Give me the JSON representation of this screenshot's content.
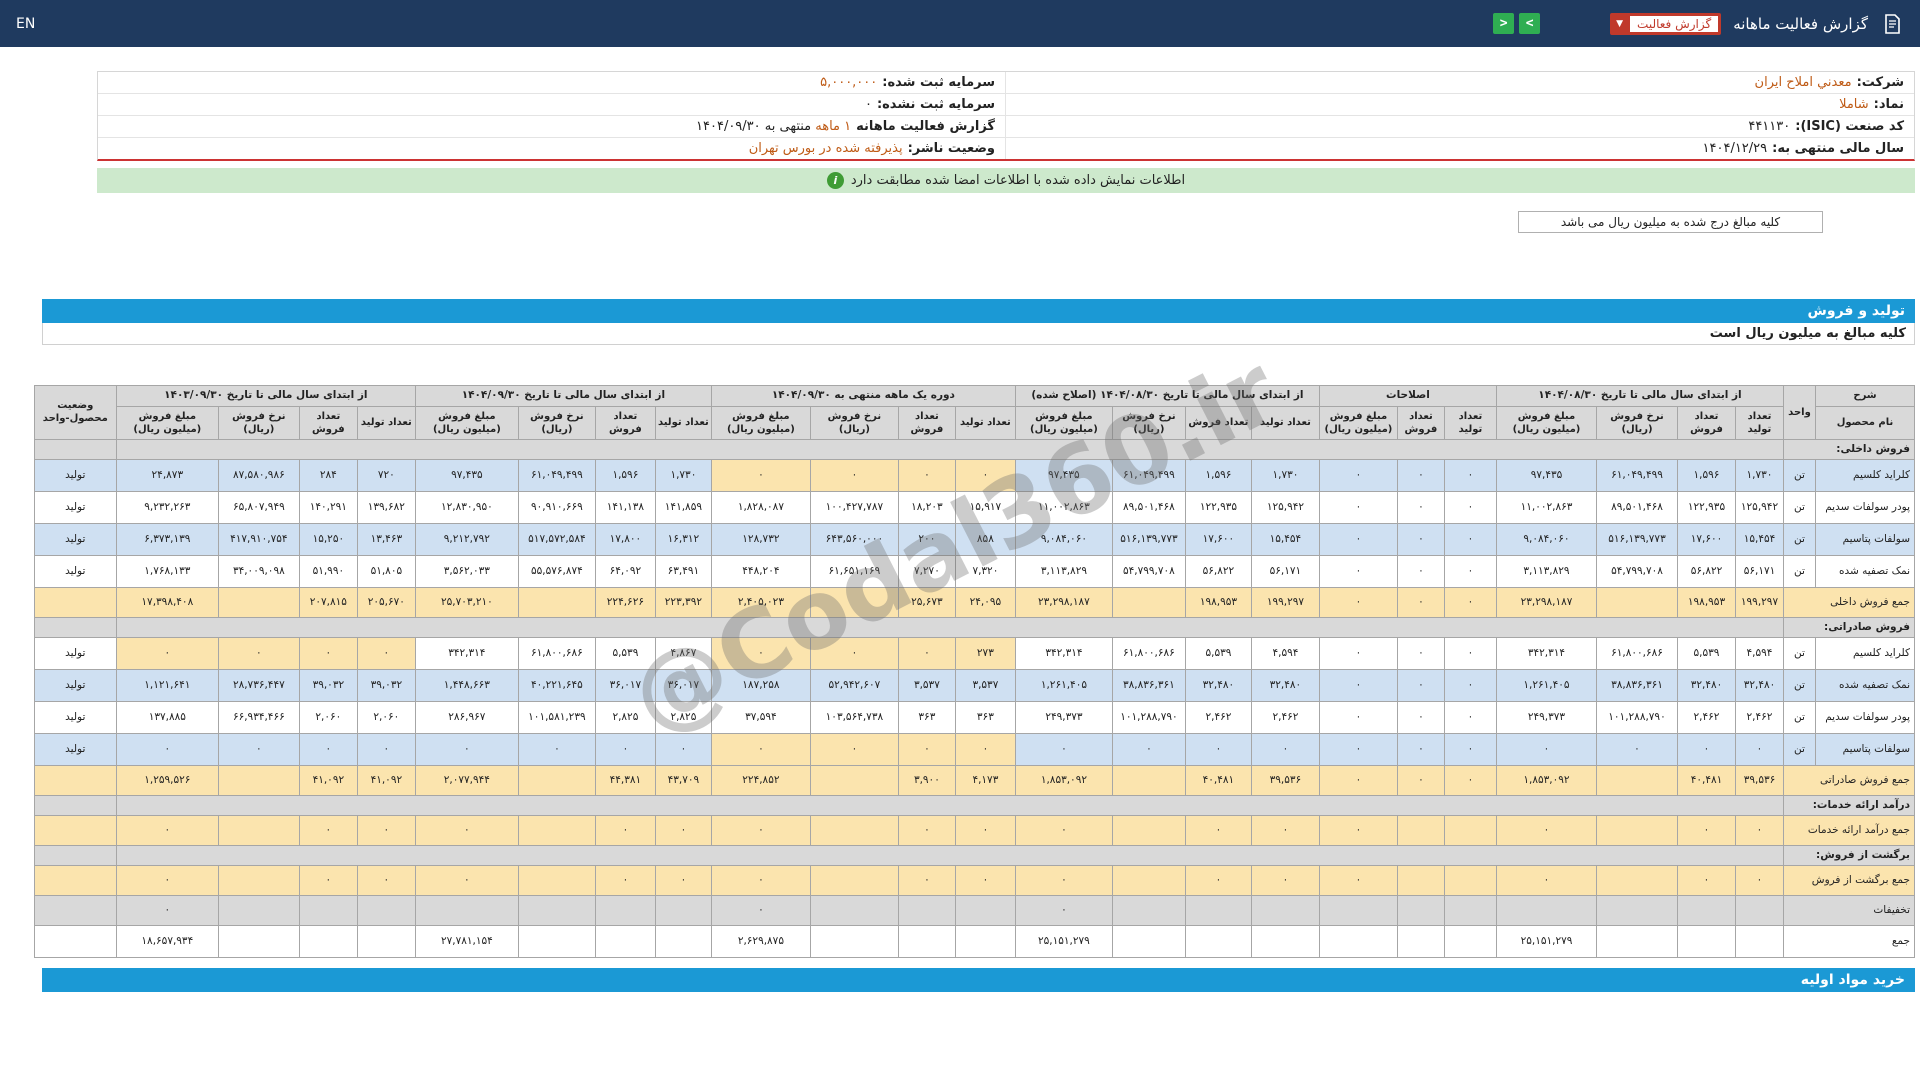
{
  "colors": {
    "navbar_bg": "#1f3a5f",
    "accent_blue": "#1b99d5",
    "accent_red": "#c0392b",
    "accent_green": "#2fae52",
    "notice_bg": "#cde9cc",
    "notice_icon": "#3f9c35",
    "cream": "#fbe4ae",
    "row_blue": "#cfe0f2",
    "grey": "#d9d9d9",
    "orange": "#bf5b16",
    "tbl_border": "#a6a6a6",
    "red_line": "#cc3333"
  },
  "navbar": {
    "brand": "گزارش فعالیت ماهانه",
    "dropdown_label": "گزارش فعالیت",
    "en_label": "EN",
    "next_label": ">",
    "prev_label": "<"
  },
  "info": {
    "rows": [
      {
        "right": {
          "label": "شرکت:",
          "value": "معدني املاح ایران",
          "cls": "orange"
        },
        "left": {
          "label": "سرمایه ثبت شده:",
          "value": "۵,۰۰۰,۰۰۰",
          "cls": "orange"
        }
      },
      {
        "right": {
          "label": "نماد:",
          "value": "شاملا",
          "cls": "orange"
        },
        "left": {
          "label": "سرمایه ثبت نشده:",
          "value": "۰",
          "cls": "dark"
        }
      },
      {
        "right": {
          "label": "کد صنعت (ISIC):",
          "value": "۴۴۱۱۳۰",
          "cls": "dark"
        },
        "left": {
          "label": "گزارش فعالیت ماهانه",
          "value": "۱ ماهه",
          "cls": "orange",
          "suffix": "منتهی به ۱۴۰۴/۰۹/۳۰"
        }
      },
      {
        "right": {
          "label": "سال مالی منتهی به:",
          "value": "۱۴۰۴/۱۲/۲۹",
          "cls": "dark"
        },
        "left": {
          "label": "وضعیت ناشر:",
          "value": "پذیرفته شده در بورس تهران",
          "cls": "orange"
        }
      }
    ]
  },
  "notice": {
    "text": "اطلاعات نمایش داده شده با اطلاعات امضا شده مطابقت دارد"
  },
  "unit_note": "کلیه مبالغ درج شده به میلیون ریال می باشد",
  "section1_title": "تولید و فروش",
  "table_note": "کلیه مبالغ به میلیون ریال است",
  "bottom_section_title": "خرید مواد اولیه",
  "watermark": "@Codal360.ir",
  "table": {
    "corner": {
      "sharh": "شرح",
      "name": "نام محصول",
      "unit": "واحد",
      "status": "وضعیت محصول-واحد"
    },
    "groups": [
      {
        "title": "از ابتدای سال مالی تا تاریخ ۱۴۰۴/۰۸/۳۰",
        "cols": [
          "تعداد تولید",
          "تعداد فروش",
          "نرخ فروش (ریال)",
          "مبلغ فروش (میلیون ریال)"
        ]
      },
      {
        "title": "اصلاحات",
        "cols": [
          "تعداد تولید",
          "تعداد فروش",
          "مبلغ فروش (میلیون ریال)"
        ]
      },
      {
        "title": "از ابتدای سال مالی تا تاریخ ۱۴۰۴/۰۸/۳۰ (اصلاح شده)",
        "cols": [
          "تعداد تولید",
          "تعداد فروش",
          "نرخ فروش (ریال)",
          "مبلغ فروش (میلیون ریال)"
        ]
      },
      {
        "title": "دوره یک ماهه منتهی به ۱۴۰۴/۰۹/۳۰",
        "cols": [
          "تعداد تولید",
          "تعداد فروش",
          "نرخ فروش (ریال)",
          "مبلغ فروش (میلیون ریال)"
        ]
      },
      {
        "title": "از ابتدای سال مالی تا تاریخ ۱۴۰۴/۰۹/۳۰",
        "cols": [
          "تعداد تولید",
          "تعداد فروش",
          "نرخ فروش (ریال)",
          "مبلغ فروش (میلیون ریال)"
        ]
      },
      {
        "title": "از ابتدای سال مالی تا تاریخ ۱۴۰۳/۰۹/۳۰",
        "cols": [
          "تعداد تولید",
          "تعداد فروش",
          "نرخ فروش (ریال)",
          "مبلغ فروش (میلیون ریال)"
        ]
      }
    ],
    "rows": [
      {
        "type": "section",
        "label": "فروش داخلی:"
      },
      {
        "type": "product",
        "name": "کلراید کلسیم",
        "unit": "تن",
        "status": "تولید",
        "cls": "blue",
        "cream": [
          3
        ],
        "g": [
          [
            "۱,۷۳۰",
            "۱,۵۹۶",
            "۶۱,۰۴۹,۴۹۹",
            "۹۷,۴۳۵"
          ],
          [
            "۰",
            "۰",
            "۰"
          ],
          [
            "۱,۷۳۰",
            "۱,۵۹۶",
            "۶۱,۰۴۹,۴۹۹",
            "۹۷,۴۳۵"
          ],
          [
            "۰",
            "۰",
            "۰",
            "۰"
          ],
          [
            "۱,۷۳۰",
            "۱,۵۹۶",
            "۶۱,۰۴۹,۴۹۹",
            "۹۷,۴۳۵"
          ],
          [
            "۷۲۰",
            "۲۸۴",
            "۸۷,۵۸۰,۹۸۶",
            "۲۴,۸۷۳"
          ]
        ]
      },
      {
        "type": "product",
        "name": "پودر سولفات سدیم",
        "unit": "تن",
        "status": "تولید",
        "cls": "white",
        "cream": [],
        "g": [
          [
            "۱۲۵,۹۴۲",
            "۱۲۲,۹۳۵",
            "۸۹,۵۰۱,۴۶۸",
            "۱۱,۰۰۲,۸۶۳"
          ],
          [
            "۰",
            "۰",
            "۰"
          ],
          [
            "۱۲۵,۹۴۲",
            "۱۲۲,۹۳۵",
            "۸۹,۵۰۱,۴۶۸",
            "۱۱,۰۰۲,۸۶۳"
          ],
          [
            "۱۵,۹۱۷",
            "۱۸,۲۰۳",
            "۱۰۰,۴۲۷,۷۸۷",
            "۱,۸۲۸,۰۸۷"
          ],
          [
            "۱۴۱,۸۵۹",
            "۱۴۱,۱۳۸",
            "۹۰,۹۱۰,۶۶۹",
            "۱۲,۸۳۰,۹۵۰"
          ],
          [
            "۱۳۹,۶۸۲",
            "۱۴۰,۲۹۱",
            "۶۵,۸۰۷,۹۴۹",
            "۹,۲۳۲,۲۶۳"
          ]
        ]
      },
      {
        "type": "product",
        "name": "سولفات پتاسیم",
        "unit": "تن",
        "status": "تولید",
        "cls": "blue",
        "cream": [],
        "g": [
          [
            "۱۵,۴۵۴",
            "۱۷,۶۰۰",
            "۵۱۶,۱۳۹,۷۷۳",
            "۹,۰۸۴,۰۶۰"
          ],
          [
            "۰",
            "۰",
            "۰"
          ],
          [
            "۱۵,۴۵۴",
            "۱۷,۶۰۰",
            "۵۱۶,۱۳۹,۷۷۳",
            "۹,۰۸۴,۰۶۰"
          ],
          [
            "۸۵۸",
            "۲۰۰",
            "۶۴۳,۵۶۰,۰۰۰",
            "۱۲۸,۷۳۲"
          ],
          [
            "۱۶,۳۱۲",
            "۱۷,۸۰۰",
            "۵۱۷,۵۷۲,۵۸۴",
            "۹,۲۱۲,۷۹۲"
          ],
          [
            "۱۳,۴۶۳",
            "۱۵,۲۵۰",
            "۴۱۷,۹۱۰,۷۵۴",
            "۶,۳۷۳,۱۳۹"
          ]
        ]
      },
      {
        "type": "product",
        "name": "نمک تصفیه شده",
        "unit": "تن",
        "status": "تولید",
        "cls": "white",
        "cream": [],
        "g": [
          [
            "۵۶,۱۷۱",
            "۵۶,۸۲۲",
            "۵۴,۷۹۹,۷۰۸",
            "۳,۱۱۳,۸۲۹"
          ],
          [
            "۰",
            "۰",
            "۰"
          ],
          [
            "۵۶,۱۷۱",
            "۵۶,۸۲۲",
            "۵۴,۷۹۹,۷۰۸",
            "۳,۱۱۳,۸۲۹"
          ],
          [
            "۷,۳۲۰",
            "۷,۲۷۰",
            "۶۱,۶۵۱,۱۶۹",
            "۴۴۸,۲۰۴"
          ],
          [
            "۶۳,۴۹۱",
            "۶۴,۰۹۲",
            "۵۵,۵۷۶,۸۷۴",
            "۳,۵۶۲,۰۳۳"
          ],
          [
            "۵۱,۸۰۵",
            "۵۱,۹۹۰",
            "۳۴,۰۰۹,۰۹۸",
            "۱,۷۶۸,۱۳۳"
          ]
        ]
      },
      {
        "type": "total",
        "label": "جمع فروش داخلی",
        "cls": "cream",
        "g": [
          [
            "۱۹۹,۲۹۷",
            "۱۹۸,۹۵۳",
            "",
            "۲۳,۲۹۸,۱۸۷"
          ],
          [
            "۰",
            "۰",
            "۰"
          ],
          [
            "۱۹۹,۲۹۷",
            "۱۹۸,۹۵۳",
            "",
            "۲۳,۲۹۸,۱۸۷"
          ],
          [
            "۲۴,۰۹۵",
            "۲۵,۶۷۳",
            "",
            "۲,۴۰۵,۰۲۳"
          ],
          [
            "۲۲۳,۳۹۲",
            "۲۲۴,۶۲۶",
            "",
            "۲۵,۷۰۳,۲۱۰"
          ],
          [
            "۲۰۵,۶۷۰",
            "۲۰۷,۸۱۵",
            "",
            "۱۷,۳۹۸,۴۰۸"
          ]
        ]
      },
      {
        "type": "section",
        "label": "فروش صادراتی:"
      },
      {
        "type": "product",
        "name": "کلراید کلسیم",
        "unit": "تن",
        "status": "تولید",
        "cls": "white",
        "cream": [
          3,
          5
        ],
        "g": [
          [
            "۴,۵۹۴",
            "۵,۵۳۹",
            "۶۱,۸۰۰,۶۸۶",
            "۳۴۲,۳۱۴"
          ],
          [
            "۰",
            "۰",
            "۰"
          ],
          [
            "۴,۵۹۴",
            "۵,۵۳۹",
            "۶۱,۸۰۰,۶۸۶",
            "۳۴۲,۳۱۴"
          ],
          [
            "۲۷۳",
            "۰",
            "۰",
            "۰"
          ],
          [
            "۴,۸۶۷",
            "۵,۵۳۹",
            "۶۱,۸۰۰,۶۸۶",
            "۳۴۲,۳۱۴"
          ],
          [
            "۰",
            "۰",
            "۰",
            "۰"
          ]
        ]
      },
      {
        "type": "product",
        "name": "نمک تصفیه شده",
        "unit": "تن",
        "status": "تولید",
        "cls": "blue",
        "cream": [],
        "g": [
          [
            "۳۲,۴۸۰",
            "۳۲,۴۸۰",
            "۳۸,۸۳۶,۳۶۱",
            "۱,۲۶۱,۴۰۵"
          ],
          [
            "۰",
            "۰",
            "۰"
          ],
          [
            "۳۲,۴۸۰",
            "۳۲,۴۸۰",
            "۳۸,۸۳۶,۳۶۱",
            "۱,۲۶۱,۴۰۵"
          ],
          [
            "۳,۵۳۷",
            "۳,۵۳۷",
            "۵۲,۹۴۲,۶۰۷",
            "۱۸۷,۲۵۸"
          ],
          [
            "۳۶,۰۱۷",
            "۳۶,۰۱۷",
            "۴۰,۲۲۱,۶۴۵",
            "۱,۴۴۸,۶۶۳"
          ],
          [
            "۳۹,۰۳۲",
            "۳۹,۰۳۲",
            "۲۸,۷۳۶,۴۴۷",
            "۱,۱۲۱,۶۴۱"
          ]
        ]
      },
      {
        "type": "product",
        "name": "پودر سولفات سدیم",
        "unit": "تن",
        "status": "تولید",
        "cls": "white",
        "cream": [],
        "g": [
          [
            "۲,۴۶۲",
            "۲,۴۶۲",
            "۱۰۱,۲۸۸,۷۹۰",
            "۲۴۹,۳۷۳"
          ],
          [
            "۰",
            "۰",
            "۰"
          ],
          [
            "۲,۴۶۲",
            "۲,۴۶۲",
            "۱۰۱,۲۸۸,۷۹۰",
            "۲۴۹,۳۷۳"
          ],
          [
            "۳۶۳",
            "۳۶۳",
            "۱۰۳,۵۶۴,۷۳۸",
            "۳۷,۵۹۴"
          ],
          [
            "۲,۸۲۵",
            "۲,۸۲۵",
            "۱۰۱,۵۸۱,۲۳۹",
            "۲۸۶,۹۶۷"
          ],
          [
            "۲,۰۶۰",
            "۲,۰۶۰",
            "۶۶,۹۳۴,۴۶۶",
            "۱۳۷,۸۸۵"
          ]
        ]
      },
      {
        "type": "product",
        "name": "سولفات پتاسیم",
        "unit": "تن",
        "status": "تولید",
        "cls": "blue",
        "cream": [
          3
        ],
        "g": [
          [
            "۰",
            "۰",
            "۰",
            "۰"
          ],
          [
            "۰",
            "۰",
            "۰"
          ],
          [
            "۰",
            "۰",
            "۰",
            "۰"
          ],
          [
            "۰",
            "۰",
            "۰",
            "۰"
          ],
          [
            "۰",
            "۰",
            "۰",
            "۰"
          ],
          [
            "۰",
            "۰",
            "۰",
            "۰"
          ]
        ]
      },
      {
        "type": "total",
        "label": "جمع فروش صادراتی",
        "cls": "cream",
        "g": [
          [
            "۳۹,۵۳۶",
            "۴۰,۴۸۱",
            "",
            "۱,۸۵۳,۰۹۲"
          ],
          [
            "۰",
            "۰",
            "۰"
          ],
          [
            "۳۹,۵۳۶",
            "۴۰,۴۸۱",
            "",
            "۱,۸۵۳,۰۹۲"
          ],
          [
            "۴,۱۷۳",
            "۳,۹۰۰",
            "",
            "۲۲۴,۸۵۲"
          ],
          [
            "۴۳,۷۰۹",
            "۴۴,۳۸۱",
            "",
            "۲,۰۷۷,۹۴۴"
          ],
          [
            "۴۱,۰۹۲",
            "۴۱,۰۹۲",
            "",
            "۱,۲۵۹,۵۲۶"
          ]
        ]
      },
      {
        "type": "section",
        "label": "درآمد ارائه خدمات:"
      },
      {
        "type": "total",
        "label": "جمع درآمد ارائه خدمات",
        "cls": "cream",
        "g": [
          [
            "۰",
            "۰",
            "",
            "۰"
          ],
          [
            "",
            "",
            "۰"
          ],
          [
            "۰",
            "۰",
            "",
            "۰"
          ],
          [
            "۰",
            "۰",
            "",
            "۰"
          ],
          [
            "۰",
            "۰",
            "",
            "۰"
          ],
          [
            "۰",
            "۰",
            "",
            "۰"
          ]
        ]
      },
      {
        "type": "section",
        "label": "برگشت از فروش:"
      },
      {
        "type": "total",
        "label": "جمع برگشت از فروش",
        "cls": "cream",
        "g": [
          [
            "۰",
            "۰",
            "",
            "۰"
          ],
          [
            "",
            "",
            "۰"
          ],
          [
            "۰",
            "۰",
            "",
            "۰"
          ],
          [
            "۰",
            "۰",
            "",
            "۰"
          ],
          [
            "۰",
            "۰",
            "",
            "۰"
          ],
          [
            "۰",
            "۰",
            "",
            "۰"
          ]
        ]
      },
      {
        "type": "total",
        "label": "تخفیفات",
        "cls": "grey",
        "g": [
          [
            "",
            "",
            "",
            ""
          ],
          [
            "",
            "",
            ""
          ],
          [
            "",
            "",
            "",
            "۰"
          ],
          [
            "",
            "",
            "",
            "۰"
          ],
          [
            "",
            "",
            "",
            ""
          ],
          [
            "",
            "",
            "",
            "۰"
          ]
        ]
      },
      {
        "type": "total",
        "label": "جمع",
        "cls": "white",
        "g": [
          [
            "",
            "",
            "",
            "۲۵,۱۵۱,۲۷۹"
          ],
          [
            "",
            "",
            ""
          ],
          [
            "",
            "",
            "",
            "۲۵,۱۵۱,۲۷۹"
          ],
          [
            "",
            "",
            "",
            "۲,۶۲۹,۸۷۵"
          ],
          [
            "",
            "",
            "",
            "۲۷,۷۸۱,۱۵۴"
          ],
          [
            "",
            "",
            "",
            "۱۸,۶۵۷,۹۳۴"
          ]
        ]
      }
    ]
  }
}
